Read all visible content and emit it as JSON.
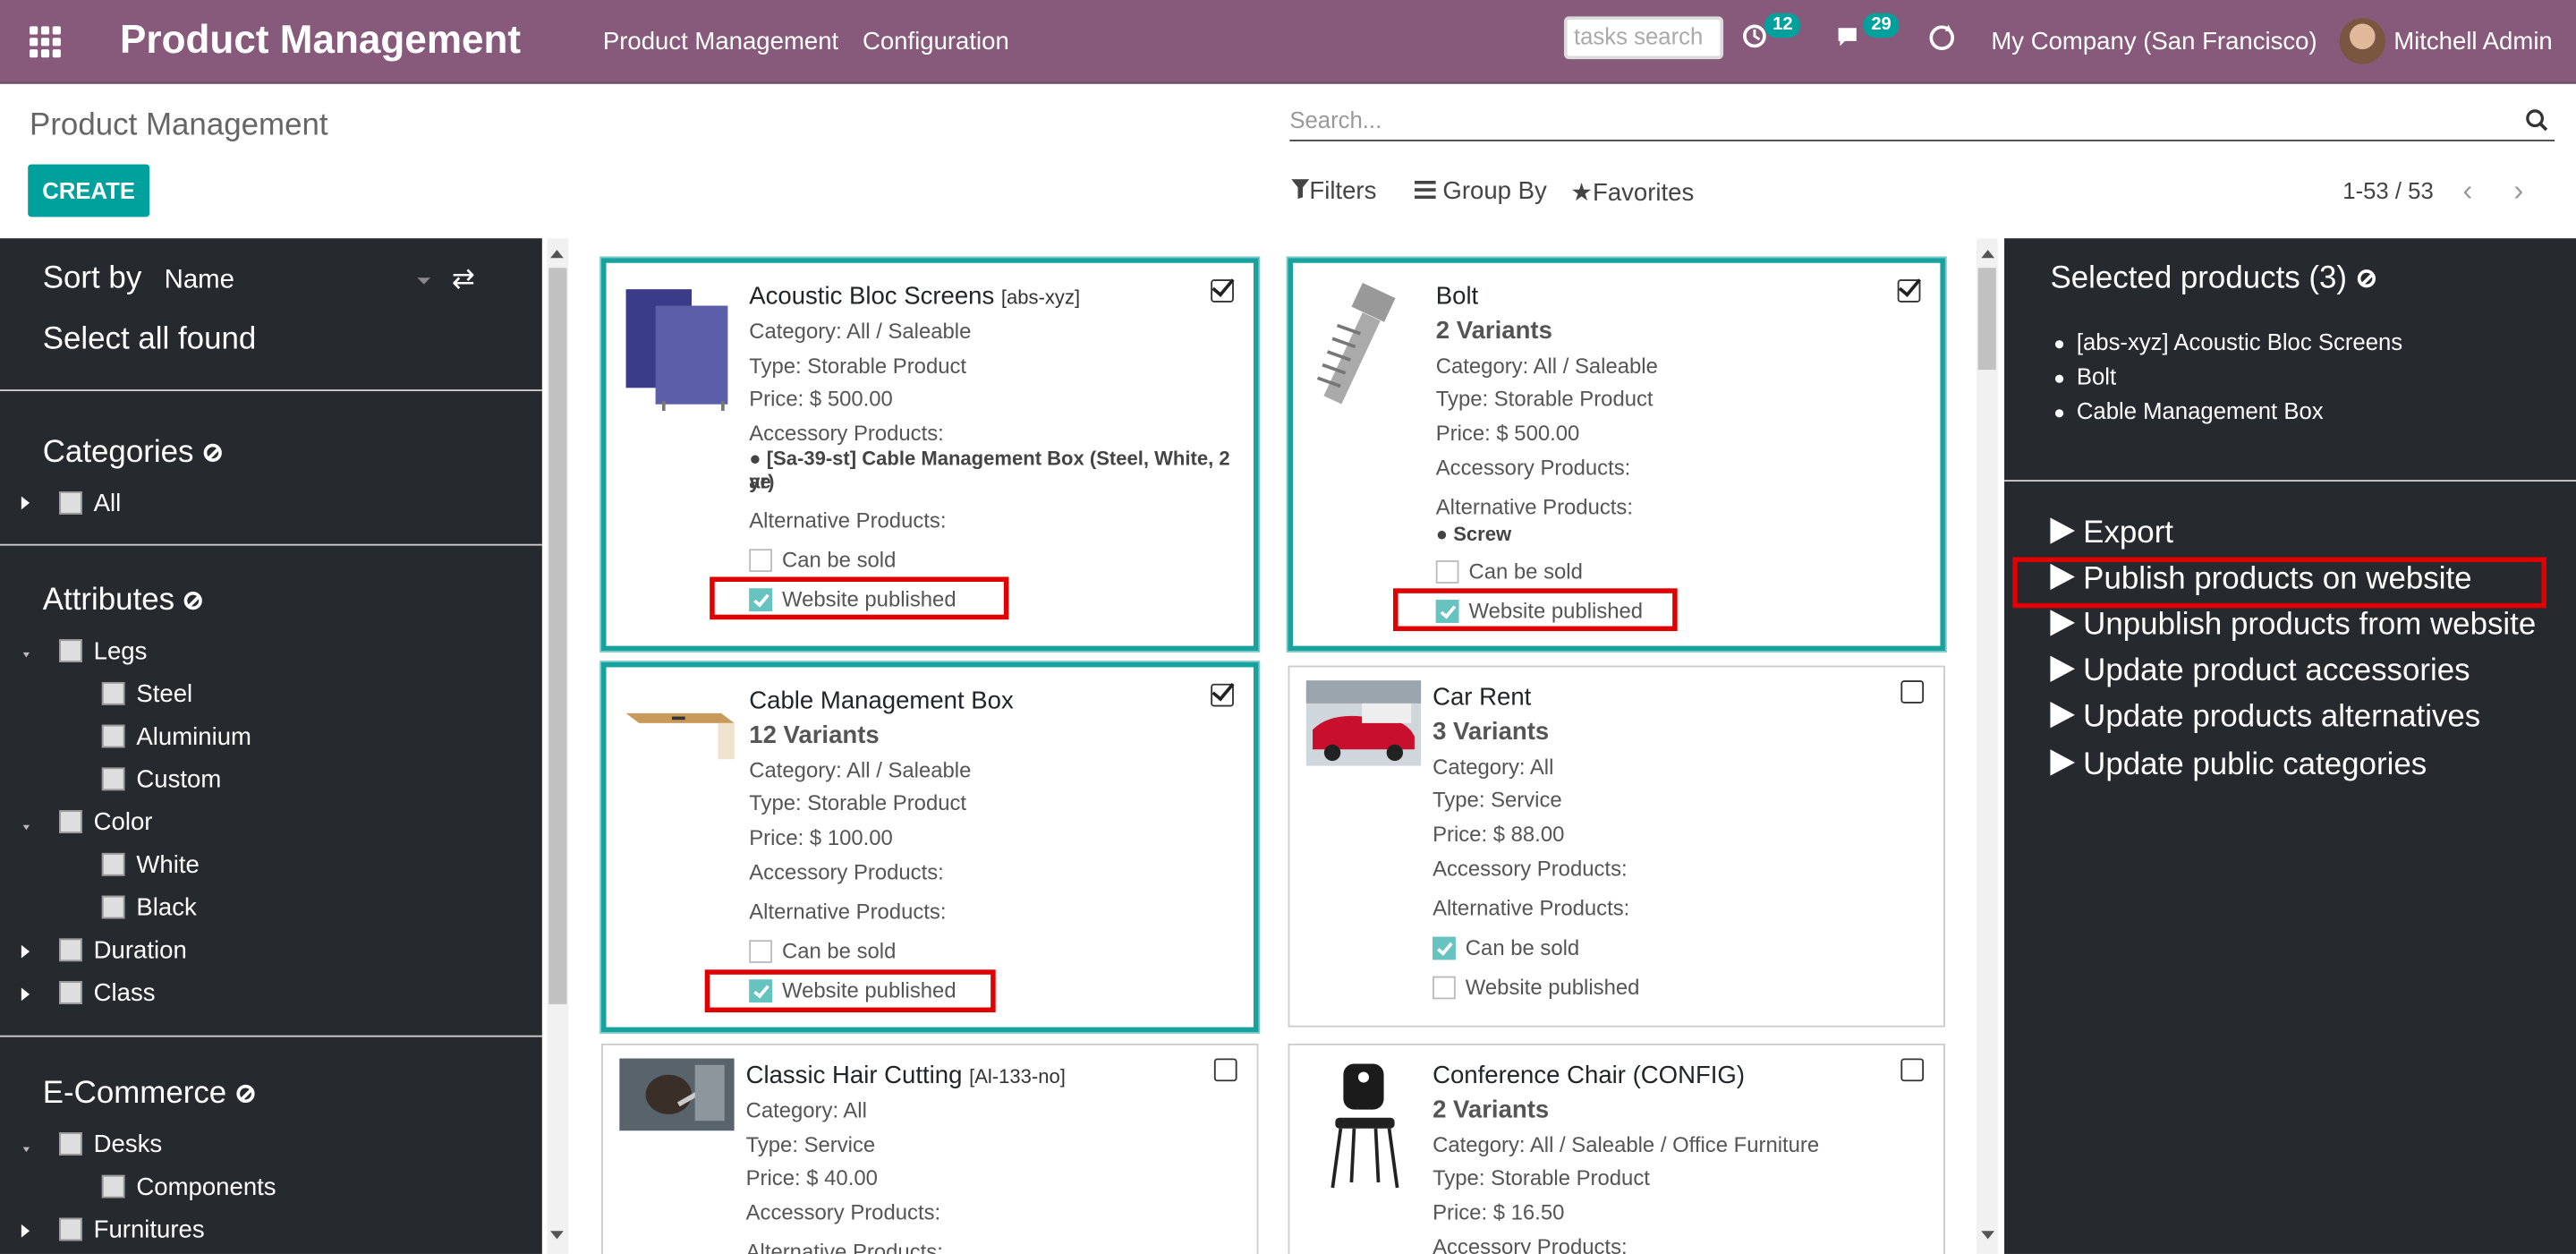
{
  "navbar": {
    "app_title": "Product Management",
    "menus": [
      "Product Management",
      "Configuration"
    ],
    "tasks_search_placeholder": "tasks search",
    "activity_count": "12",
    "messages_count": "29",
    "company": "My Company (San Francisco)",
    "user": "Mitchell Admin"
  },
  "control_panel": {
    "title": "Product Management",
    "create_label": "CREATE",
    "search_placeholder": "Search...",
    "filters_label": "Filters",
    "group_by_label": "Group By",
    "favorites_label": "Favorites",
    "pager": "1-53 / 53"
  },
  "left_panel": {
    "sort_by_label": "Sort by",
    "sort_value": "Name",
    "select_all_label": "Select all found",
    "categories": {
      "title": "Categories",
      "items": [
        "All"
      ]
    },
    "attributes": {
      "title": "Attributes",
      "items": [
        "Legs",
        "Steel",
        "Aluminium",
        "Custom",
        "Color",
        "White",
        "Black",
        "Duration",
        "Class"
      ]
    },
    "ecommerce": {
      "title": "E-Commerce",
      "items": [
        "Desks",
        "Components",
        "Furnitures"
      ]
    }
  },
  "labels": {
    "accessory": "Accessory Products:",
    "alternative": "Alternative Products:",
    "can_be_sold": "Can be sold",
    "website_published": "Website published"
  },
  "products": [
    {
      "name": "Acoustic Bloc Screens",
      "ref": "[abs-xyz]",
      "variants": "",
      "category": "Category: All / Saleable",
      "type": "Type: Storable Product",
      "price": "Price: $ 500.00",
      "accessory_items": [
        "[Sa-39-st] Cable Management Box (Steel, White, 2 ye",
        "ar)"
      ],
      "alternative_items": [],
      "can_be_sold": false,
      "website_published": true,
      "selected": true
    },
    {
      "name": "Bolt",
      "ref": "",
      "variants": "2 Variants",
      "category": "Category: All / Saleable",
      "type": "Type: Storable Product",
      "price": "Price: $ 500.00",
      "accessory_items": [],
      "alternative_items": [
        "Screw"
      ],
      "can_be_sold": false,
      "website_published": true,
      "selected": true
    },
    {
      "name": "Cable Management Box",
      "ref": "",
      "variants": "12 Variants",
      "category": "Category: All / Saleable",
      "type": "Type: Storable Product",
      "price": "Price: $ 100.00",
      "accessory_items": [],
      "alternative_items": [],
      "can_be_sold": false,
      "website_published": true,
      "selected": true
    },
    {
      "name": "Car Rent",
      "ref": "",
      "variants": "3 Variants",
      "category": "Category: All",
      "type": "Type: Service",
      "price": "Price: $ 88.00",
      "accessory_items": [],
      "alternative_items": [],
      "can_be_sold": true,
      "website_published": false,
      "selected": false
    },
    {
      "name": "Classic Hair Cutting",
      "ref": "[Al-133-no]",
      "variants": "",
      "category": "Category: All",
      "type": "Type: Service",
      "price": "Price: $ 40.00",
      "accessory_items": [],
      "alternative_items": [],
      "selected": false
    },
    {
      "name": "Conference Chair (CONFIG)",
      "ref": "",
      "variants": "2 Variants",
      "category": "Category: All / Saleable / Office Furniture",
      "type": "Type: Storable Product",
      "price": "Price: $ 16.50",
      "accessory_items": [],
      "alternative_items": [],
      "selected": false
    }
  ],
  "right_panel": {
    "title": "Selected products (3)",
    "selected": [
      "[abs-xyz] Acoustic Bloc Screens",
      "Bolt",
      "Cable Management Box"
    ],
    "actions": [
      "Export",
      "Publish products on website",
      "Unpublish products from website",
      "Update product accessories",
      "Update products alternatives",
      "Update public categories"
    ]
  },
  "colors": {
    "navbar": "#875a7b",
    "accent": "#00a09d",
    "panel": "#262a2f",
    "highlight": "#e00000"
  }
}
